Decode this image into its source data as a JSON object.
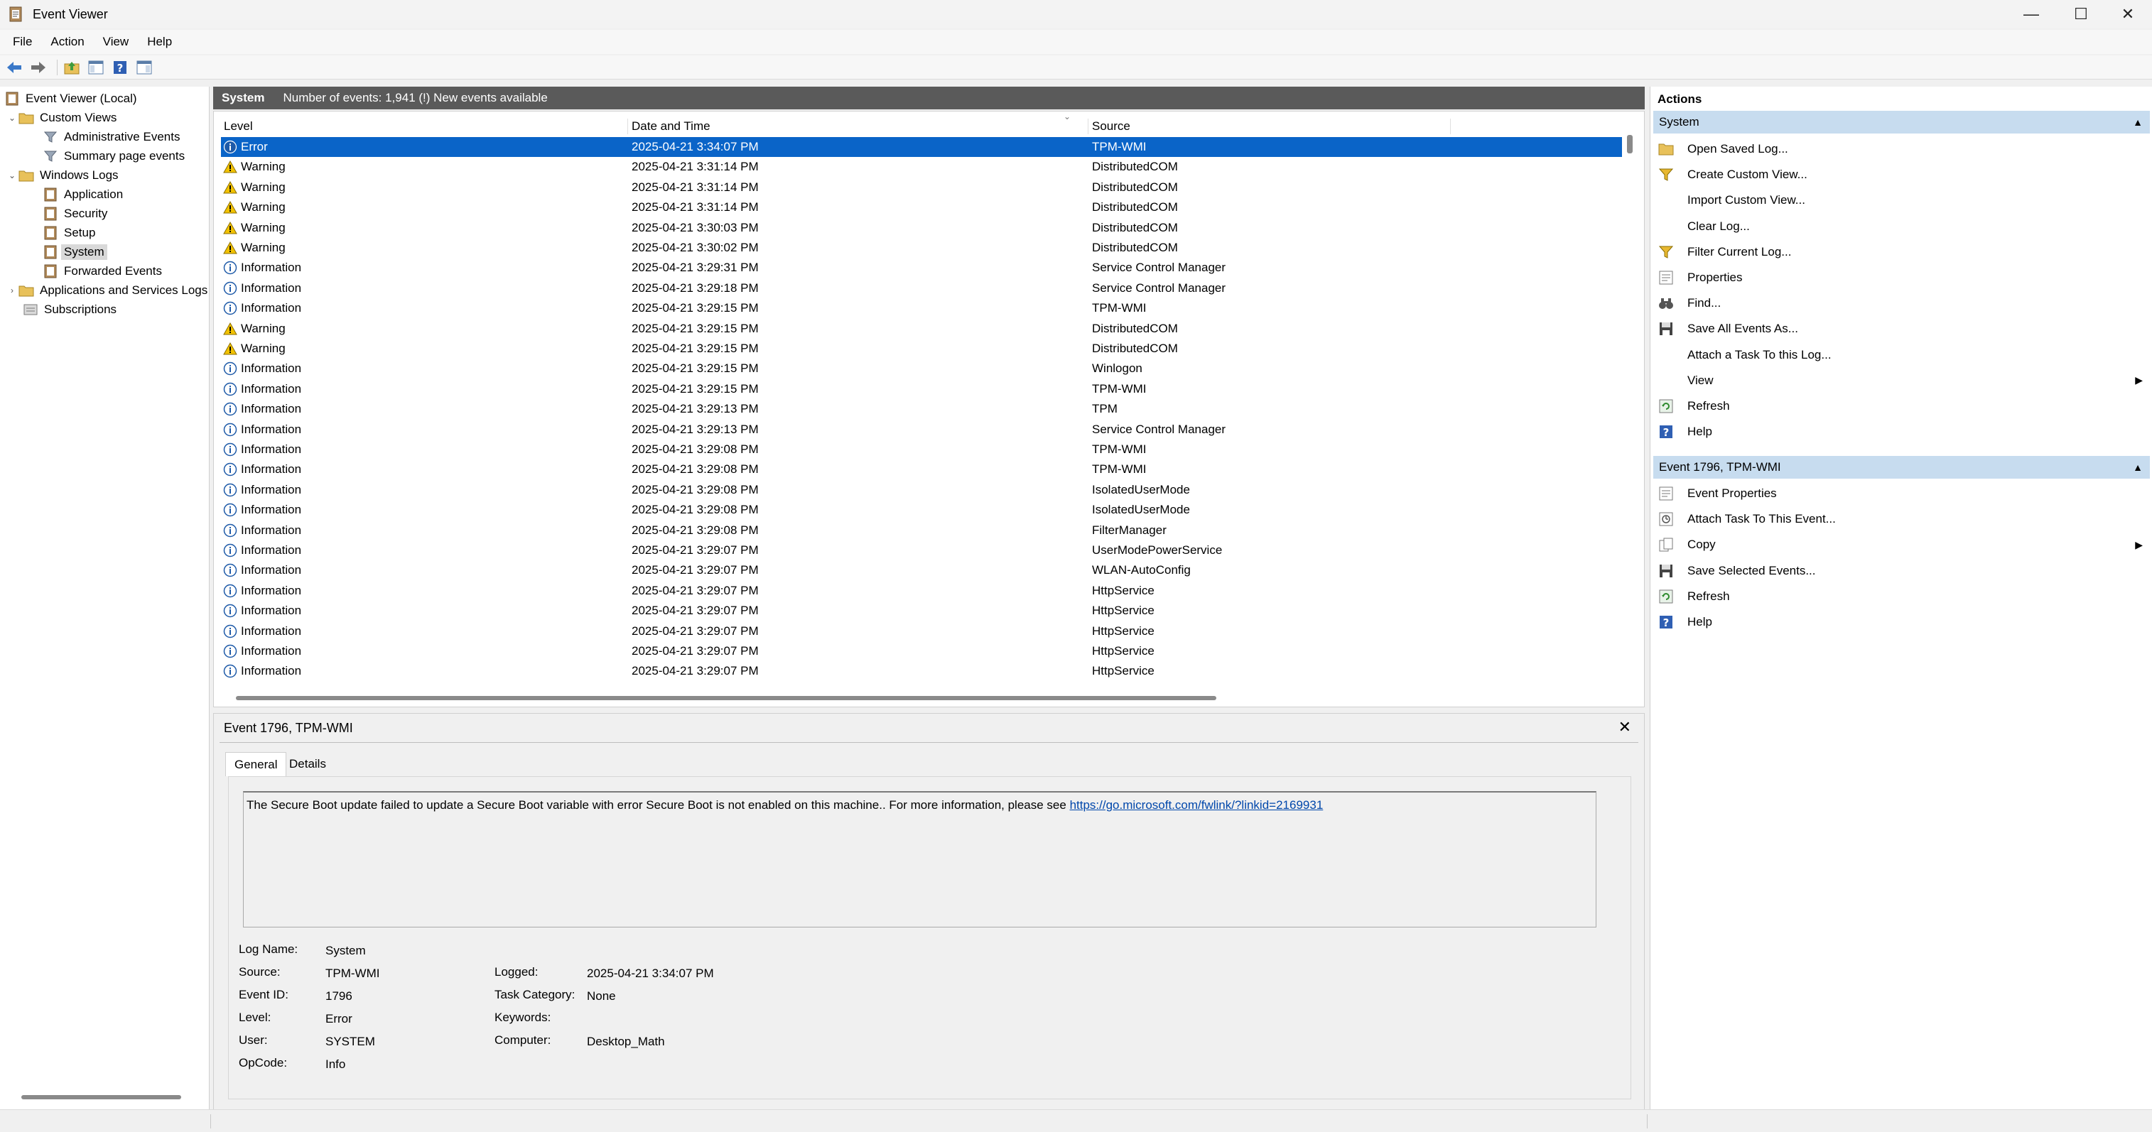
{
  "window": {
    "title": "Event Viewer",
    "minimize": "—",
    "maximize": "☐",
    "close": "✕"
  },
  "menu": [
    "File",
    "Action",
    "View",
    "Help"
  ],
  "tree": {
    "root": "Event Viewer (Local)",
    "custom_views": "Custom Views",
    "administrative_events": "Administrative Events",
    "summary_page_events": "Summary page events",
    "windows_logs": "Windows Logs",
    "application": "Application",
    "security": "Security",
    "setup": "Setup",
    "system": "System",
    "forwarded_events": "Forwarded Events",
    "apps_services": "Applications and Services Logs",
    "subscriptions": "Subscriptions"
  },
  "list": {
    "log_name": "System",
    "summary": "Number of events: 1,941 (!) New events available",
    "columns": {
      "level": "Level",
      "datetime": "Date and Time",
      "source": "Source"
    },
    "rows": [
      {
        "level": "Error",
        "dt": "2025-04-21 3:34:07 PM",
        "src": "TPM-WMI"
      },
      {
        "level": "Warning",
        "dt": "2025-04-21 3:31:14 PM",
        "src": "DistributedCOM"
      },
      {
        "level": "Warning",
        "dt": "2025-04-21 3:31:14 PM",
        "src": "DistributedCOM"
      },
      {
        "level": "Warning",
        "dt": "2025-04-21 3:31:14 PM",
        "src": "DistributedCOM"
      },
      {
        "level": "Warning",
        "dt": "2025-04-21 3:30:03 PM",
        "src": "DistributedCOM"
      },
      {
        "level": "Warning",
        "dt": "2025-04-21 3:30:02 PM",
        "src": "DistributedCOM"
      },
      {
        "level": "Information",
        "dt": "2025-04-21 3:29:31 PM",
        "src": "Service Control Manager"
      },
      {
        "level": "Information",
        "dt": "2025-04-21 3:29:18 PM",
        "src": "Service Control Manager"
      },
      {
        "level": "Information",
        "dt": "2025-04-21 3:29:15 PM",
        "src": "TPM-WMI"
      },
      {
        "level": "Warning",
        "dt": "2025-04-21 3:29:15 PM",
        "src": "DistributedCOM"
      },
      {
        "level": "Warning",
        "dt": "2025-04-21 3:29:15 PM",
        "src": "DistributedCOM"
      },
      {
        "level": "Information",
        "dt": "2025-04-21 3:29:15 PM",
        "src": "Winlogon"
      },
      {
        "level": "Information",
        "dt": "2025-04-21 3:29:15 PM",
        "src": "TPM-WMI"
      },
      {
        "level": "Information",
        "dt": "2025-04-21 3:29:13 PM",
        "src": "TPM"
      },
      {
        "level": "Information",
        "dt": "2025-04-21 3:29:13 PM",
        "src": "Service Control Manager"
      },
      {
        "level": "Information",
        "dt": "2025-04-21 3:29:08 PM",
        "src": "TPM-WMI"
      },
      {
        "level": "Information",
        "dt": "2025-04-21 3:29:08 PM",
        "src": "TPM-WMI"
      },
      {
        "level": "Information",
        "dt": "2025-04-21 3:29:08 PM",
        "src": "IsolatedUserMode"
      },
      {
        "level": "Information",
        "dt": "2025-04-21 3:29:08 PM",
        "src": "IsolatedUserMode"
      },
      {
        "level": "Information",
        "dt": "2025-04-21 3:29:08 PM",
        "src": "FilterManager"
      },
      {
        "level": "Information",
        "dt": "2025-04-21 3:29:07 PM",
        "src": "UserModePowerService"
      },
      {
        "level": "Information",
        "dt": "2025-04-21 3:29:07 PM",
        "src": "WLAN-AutoConfig"
      },
      {
        "level": "Information",
        "dt": "2025-04-21 3:29:07 PM",
        "src": "HttpService"
      },
      {
        "level": "Information",
        "dt": "2025-04-21 3:29:07 PM",
        "src": "HttpService"
      },
      {
        "level": "Information",
        "dt": "2025-04-21 3:29:07 PM",
        "src": "HttpService"
      },
      {
        "level": "Information",
        "dt": "2025-04-21 3:29:07 PM",
        "src": "HttpService"
      },
      {
        "level": "Information",
        "dt": "2025-04-21 3:29:07 PM",
        "src": "HttpService"
      }
    ]
  },
  "detail": {
    "title": "Event 1796, TPM-WMI",
    "close": "✕",
    "tabs": {
      "general": "General",
      "details": "Details"
    },
    "description": "The Secure Boot update failed to update a Secure Boot variable with error Secure Boot is not enabled on this machine.. For more information, please see ",
    "link": "https://go.microsoft.com/fwlink/?linkid=2169931",
    "labels": {
      "log_name": "Log Name:",
      "source": "Source:",
      "event_id": "Event ID:",
      "level": "Level:",
      "user": "User:",
      "opcode": "OpCode:",
      "logged": "Logged:",
      "task_category": "Task Category:",
      "keywords": "Keywords:",
      "computer": "Computer:"
    },
    "values": {
      "log_name": "System",
      "source": "TPM-WMI",
      "event_id": "1796",
      "level": "Error",
      "user": "SYSTEM",
      "opcode": "Info",
      "logged": "2025-04-21 3:34:07 PM",
      "task_category": "None",
      "keywords": "",
      "computer": "Desktop_Math"
    }
  },
  "actions": {
    "title": "Actions",
    "section1": "System",
    "section1_items": [
      {
        "label": "Open Saved Log...",
        "icon": "folder-icon"
      },
      {
        "label": "Create Custom View...",
        "icon": "filter-icon"
      },
      {
        "label": "Import Custom View...",
        "icon": ""
      },
      {
        "label": "Clear Log...",
        "icon": ""
      },
      {
        "label": "Filter Current Log...",
        "icon": "filter-icon"
      },
      {
        "label": "Properties",
        "icon": "properties-icon"
      },
      {
        "label": "Find...",
        "icon": "binoculars-icon"
      },
      {
        "label": "Save All Events As...",
        "icon": "save-icon"
      },
      {
        "label": "Attach a Task To this Log...",
        "icon": ""
      },
      {
        "label": "View",
        "icon": "",
        "submenu": true
      },
      {
        "label": "Refresh",
        "icon": "refresh-icon"
      },
      {
        "label": "Help",
        "icon": "help-icon"
      }
    ],
    "section2": "Event 1796, TPM-WMI",
    "section2_items": [
      {
        "label": "Event Properties",
        "icon": "properties-icon"
      },
      {
        "label": "Attach Task To This Event...",
        "icon": "task-icon"
      },
      {
        "label": "Copy",
        "icon": "copy-icon",
        "submenu": true
      },
      {
        "label": "Save Selected Events...",
        "icon": "save-icon"
      },
      {
        "label": "Refresh",
        "icon": "refresh-icon"
      },
      {
        "label": "Help",
        "icon": "help-icon"
      }
    ]
  },
  "colors": {
    "selection": "#0a64c8",
    "header_bar": "#5a5a5a",
    "section_bg": "#c7dcef",
    "warning": "#f2c200",
    "info": "#1e5aa8",
    "error": "#c42b1c"
  }
}
